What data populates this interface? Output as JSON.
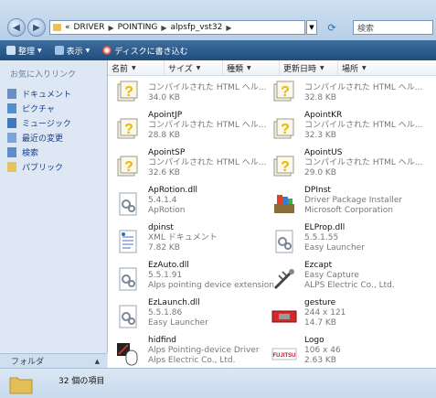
{
  "address": {
    "prefix": "«",
    "crumbs": [
      "DRIVER",
      "POINTING",
      "alpsfp_vst32"
    ],
    "search_placeholder": "検索"
  },
  "toolbar": {
    "organize_label": "整理",
    "views_label": "表示",
    "burn_label": "ディスクに書き込む"
  },
  "nav": {
    "title": "お気に入りリンク",
    "items": [
      {
        "label": "ドキュメント",
        "icon": "documents-icon"
      },
      {
        "label": "ピクチャ",
        "icon": "pictures-icon"
      },
      {
        "label": "ミュージック",
        "icon": "music-icon"
      },
      {
        "label": "最近の変更",
        "icon": "recent-icon"
      },
      {
        "label": "検索",
        "icon": "search-folder-icon"
      },
      {
        "label": "パブリック",
        "icon": "public-icon"
      }
    ],
    "folder_label": "フォルダ"
  },
  "columns": [
    "名前",
    "サイズ",
    "種類",
    "更新日時",
    "場所"
  ],
  "files": [
    {
      "name": "",
      "line2": "コンパイルされた HTML ヘル...",
      "line3": "34.0 KB",
      "icon": "chm-icon"
    },
    {
      "name": "",
      "line2": "コンパイルされた HTML ヘル...",
      "line3": "32.8 KB",
      "icon": "chm-icon"
    },
    {
      "name": "ApointJP",
      "line2": "コンパイルされた HTML ヘル...",
      "line3": "28.8 KB",
      "icon": "chm-icon"
    },
    {
      "name": "ApointKR",
      "line2": "コンパイルされた HTML ヘル...",
      "line3": "32.3 KB",
      "icon": "chm-icon"
    },
    {
      "name": "ApointSP",
      "line2": "コンパイルされた HTML ヘル...",
      "line3": "32.6 KB",
      "icon": "chm-icon"
    },
    {
      "name": "ApointUS",
      "line2": "コンパイルされた HTML ヘル...",
      "line3": "29.0 KB",
      "icon": "chm-icon"
    },
    {
      "name": "ApRotion.dll",
      "line2": "5.4.1.4",
      "line3": "ApRotion",
      "icon": "dll-icon"
    },
    {
      "name": "DPInst",
      "line2": "Driver Package Installer",
      "line3": "Microsoft Corporation",
      "icon": "installer-icon"
    },
    {
      "name": "dpinst",
      "line2": "XML ドキュメント",
      "line3": "7.82 KB",
      "icon": "xml-icon"
    },
    {
      "name": "ELProp.dll",
      "line2": "5.5.1.55",
      "line3": "Easy Launcher",
      "icon": "dll-icon"
    },
    {
      "name": "EzAuto.dll",
      "line2": "5.5.1.91",
      "line3": "Alps pointing device extension",
      "icon": "dll-icon"
    },
    {
      "name": "Ezcapt",
      "line2": "Easy Capture",
      "line3": "ALPS Electric Co., Ltd.",
      "icon": "capture-icon"
    },
    {
      "name": "EzLaunch.dll",
      "line2": "5.5.1.86",
      "line3": "Easy Launcher",
      "icon": "dll-icon"
    },
    {
      "name": "gesture",
      "line2": "244 x 121",
      "line3": "14.7 KB",
      "icon": "image-icon"
    },
    {
      "name": "hidfind",
      "line2": "Alps Pointing-device Driver",
      "line3": "Alps Electric Co., Ltd.",
      "icon": "hidfind-icon"
    },
    {
      "name": "Logo",
      "line2": "106 x 46",
      "line3": "2.63 KB",
      "icon": "logo-image-icon"
    }
  ],
  "status": {
    "text": "32 個の項目"
  },
  "colors": {
    "accent": "#2f6db5",
    "toolbar": "#2a5a8a",
    "nav_text": "#17408a"
  }
}
